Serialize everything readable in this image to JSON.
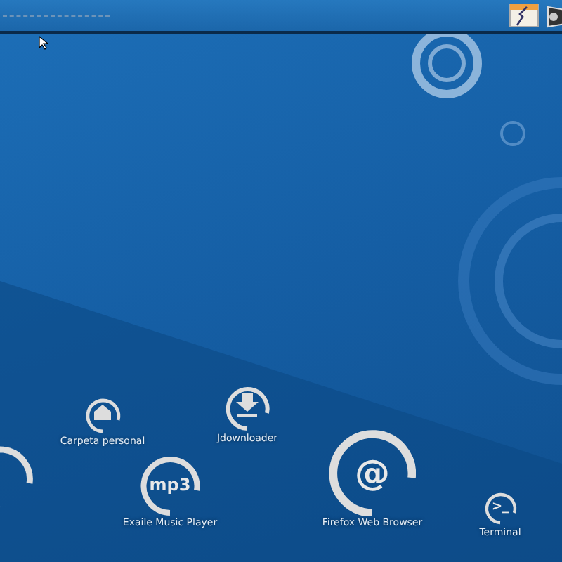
{
  "panel": {
    "tray": [
      {
        "kind": "network"
      },
      {
        "kind": "speaker"
      }
    ]
  },
  "desktop_icons": [
    {
      "kind": "blank"
    },
    {
      "kind": "home",
      "label": "Carpeta personal"
    },
    {
      "kind": "download",
      "label": "Jdownloader"
    },
    {
      "kind": "glyph",
      "glyph": "mp3",
      "label": "Exaile Music Player"
    },
    {
      "kind": "glyph",
      "glyph": "@",
      "label": "Firefox Web Browser"
    },
    {
      "kind": "glyph",
      "glyph": ">_",
      "label": "Terminal"
    }
  ]
}
